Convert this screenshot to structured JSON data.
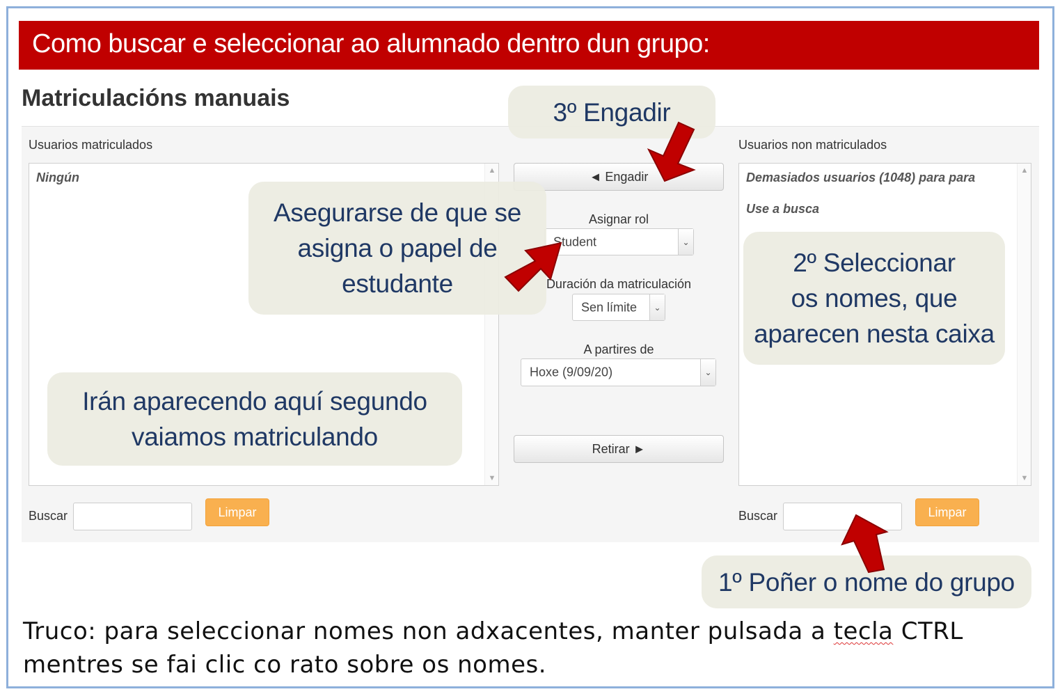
{
  "banner": {
    "title": "Como buscar e seleccionar ao alumnado dentro dun grupo:"
  },
  "page": {
    "title": "Matriculacións manuais"
  },
  "enrolled": {
    "label": "Usuarios matriculados",
    "items": [
      "Ningún"
    ],
    "search_label": "Buscar",
    "search_value": "",
    "clear_label": "Limpar"
  },
  "not_enrolled": {
    "label": "Usuarios non matriculados",
    "items": [
      "Demasiados usuarios (1048) para para",
      "Use a busca"
    ],
    "search_label": "Buscar",
    "search_value": "",
    "clear_label": "Limpar"
  },
  "middle": {
    "add_label": "◄ Engadir",
    "remove_label": "Retirar ►",
    "role_label": "Asignar rol",
    "role_value": "Student",
    "duration_label": "Duración da matriculación",
    "duration_value": "Sen límite",
    "start_label": "A partires de",
    "start_value": "Hoxe (9/09/20)"
  },
  "callouts": {
    "step3": "3º Engadir",
    "role": [
      "Asegurarse de que se",
      "asigna o papel de",
      "estudante"
    ],
    "step2": [
      "2º Seleccionar",
      "os nomes, que",
      "aparecen nesta caixa"
    ],
    "enrolled_note": [
      "Irán aparecendo aquí segundo",
      "vaiamos matriculando"
    ],
    "step1": "1º Poñer o nome do grupo"
  },
  "tip": {
    "line1_a": "Truco: para seleccionar nomes non adxacentes, manter pulsada a ",
    "line1_word": "tecla",
    "line1_b": " CTRL",
    "line2": "mentres se fai clic co rato sobre os nomes."
  },
  "colors": {
    "banner": "#c00000",
    "callout_text": "#1f3864",
    "arrow": "#c00000",
    "clear_button": "#f9b04f"
  }
}
